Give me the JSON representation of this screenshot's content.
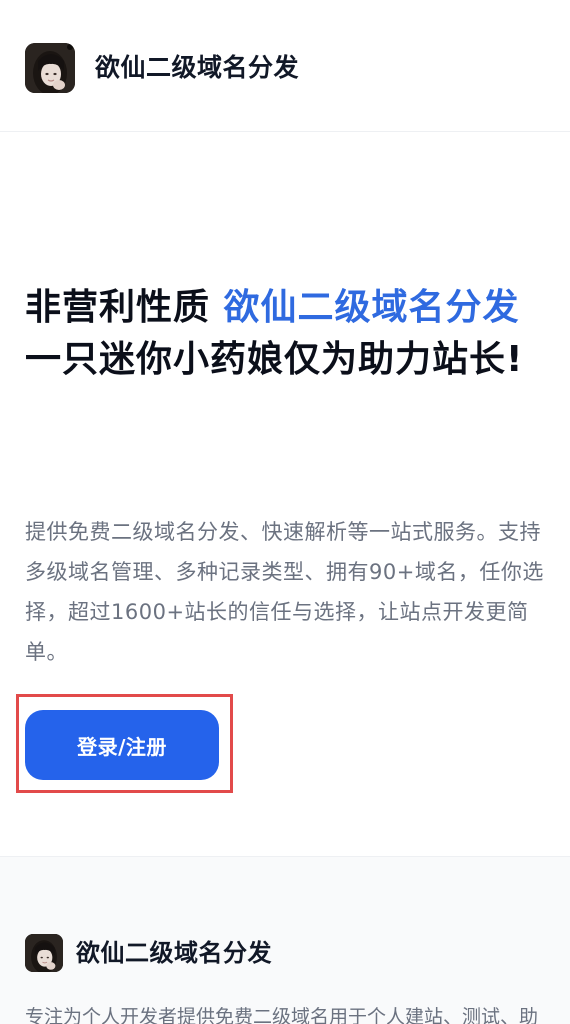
{
  "header": {
    "site_name": "欲仙二级域名分发",
    "avatar_icon": "user-avatar-photo"
  },
  "hero": {
    "title_part1": "非营利性质 ",
    "title_accent": "欲仙二级域名分发",
    "title_line2": "一只迷你小药娘仅为助力站长!",
    "description": "提供免费二级域名分发、快速解析等一站式服务。支持多级域名管理、多种记录类型、拥有90+域名，任你选择，超过1600+站长的信任与选择，让站点开发更简单。",
    "accent_color": "#2f6ae0"
  },
  "cta": {
    "label": "登录/注册",
    "button_color": "#2563eb",
    "highlight_color": "#e24a4a"
  },
  "footer": {
    "site_name": "欲仙二级域名分发",
    "description": "专注为个人开发者提供免费二级域名用于个人建站、测试、助"
  }
}
